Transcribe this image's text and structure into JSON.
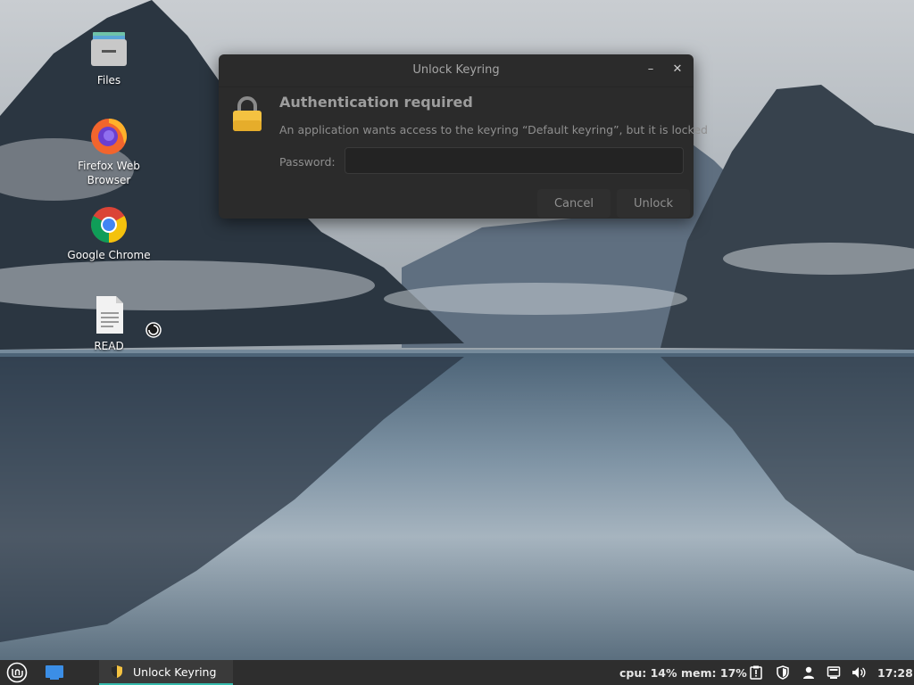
{
  "desktop": {
    "icons": [
      {
        "label": "Files"
      },
      {
        "label": "Firefox Web Browser"
      },
      {
        "label": "Google Chrome"
      },
      {
        "label": "READ"
      }
    ]
  },
  "dialog": {
    "title": "Unlock Keyring",
    "heading": "Authentication required",
    "message": "An application wants access to the keyring “Default keyring”, but it is locked",
    "password_label": "Password:",
    "password_value": "",
    "cancel_label": "Cancel",
    "unlock_label": "Unlock",
    "minimize_glyph": "–",
    "close_glyph": "✕"
  },
  "taskbar": {
    "window_label": "Unlock Keyring",
    "cpu": "cpu: 14%",
    "mem": "mem: 17%",
    "clock": "17:28"
  },
  "colors": {
    "taskbar_bg": "#2e2e2e",
    "accent": "#35b9ab",
    "dialog_bg": "#2b2b2b",
    "lock": "#f4c241"
  }
}
